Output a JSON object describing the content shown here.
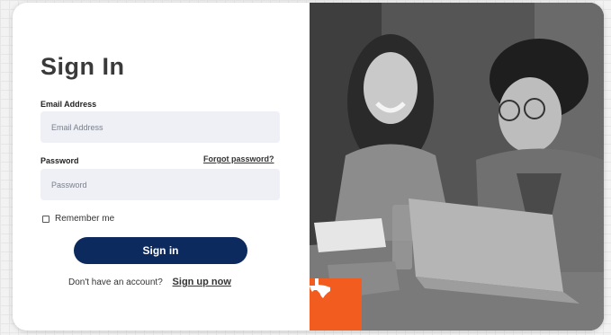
{
  "form": {
    "title": "Sign In",
    "email_label": "Email Address",
    "email_placeholder": "Email Address",
    "email_value": "",
    "password_label": "Password",
    "password_placeholder": "Password",
    "password_value": "",
    "forgot_link": "Forgot password?",
    "remember_label": "Remember me",
    "remember_checked": false,
    "signin_label": "Sign in",
    "signup_prompt": "Don't have an account?",
    "signup_link": "Sign up now"
  },
  "photo": {
    "badge_icon": "texas-state-icon",
    "badge_color": "#f25c1f"
  },
  "colors": {
    "primary_button": "#0c2a5e",
    "input_background": "#eef0f6"
  }
}
